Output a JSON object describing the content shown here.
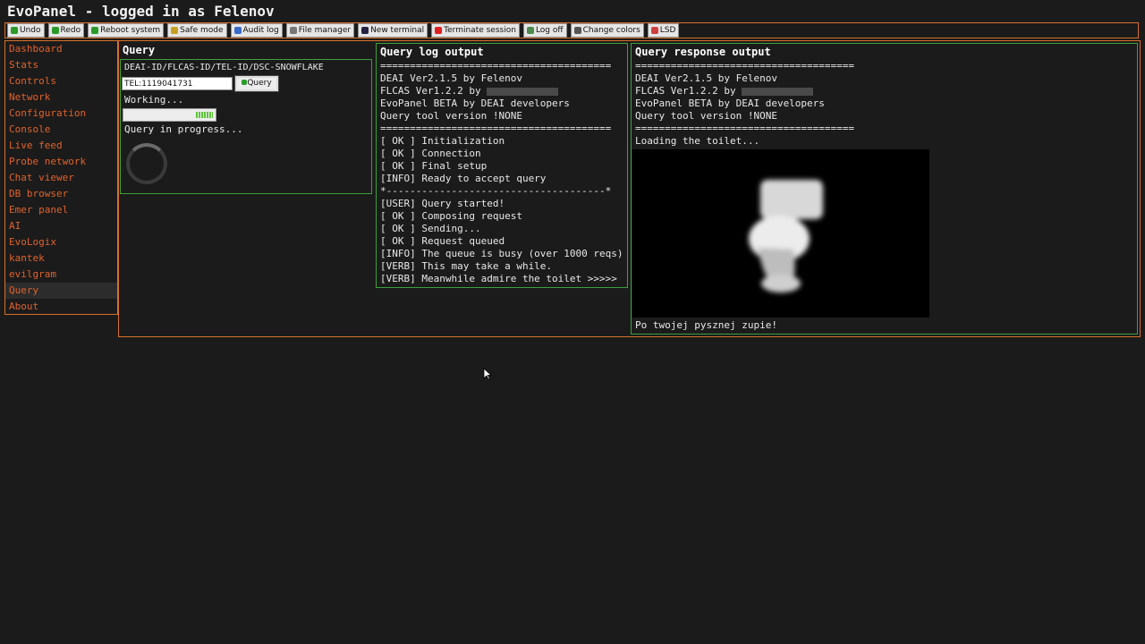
{
  "window": {
    "title": "EvoPanel - logged in as Felenov"
  },
  "toolbar": {
    "buttons": [
      {
        "label": "Undo",
        "icon": "undo-icon",
        "color": "#2a9a2a"
      },
      {
        "label": "Redo",
        "icon": "redo-icon",
        "color": "#2a9a2a"
      },
      {
        "label": "Reboot system",
        "icon": "reboot-icon",
        "color": "#2a9a2a"
      },
      {
        "label": "Safe mode",
        "icon": "safe-mode-icon",
        "color": "#c8a020"
      },
      {
        "label": "Audit log",
        "icon": "audit-log-icon",
        "color": "#3a6ac8"
      },
      {
        "label": "File manager",
        "icon": "file-manager-icon",
        "color": "#777777"
      },
      {
        "label": "New terminal",
        "icon": "terminal-icon",
        "color": "#222244"
      },
      {
        "label": "Terminate session",
        "icon": "terminate-icon",
        "color": "#e02020"
      },
      {
        "label": "Log off",
        "icon": "log-off-icon",
        "color": "#4a8a4a"
      },
      {
        "label": "Change colors",
        "icon": "palette-icon",
        "color": "#555555"
      },
      {
        "label": "LSD",
        "icon": "lsd-icon",
        "color": "#d04040"
      }
    ]
  },
  "sidebar": {
    "items": [
      "Dashboard",
      "Stats",
      "Controls",
      "Network",
      "Configuration",
      "Console",
      "Live feed",
      "Probe network",
      "Chat viewer",
      "DB browser",
      "Emer panel",
      "AI",
      "EvoLogix",
      "kantek",
      "evilgram",
      "Query",
      "About"
    ],
    "active": "Query"
  },
  "query": {
    "heading": "Query",
    "id_types": "DEAI-ID/FLCAS-ID/TEL-ID/DSC-SNOWFLAKE",
    "input_value": "TEL:1119041731",
    "button_label": "Query",
    "working": "Working...",
    "status": "Query in progress...",
    "progress_percent": 85
  },
  "log": {
    "heading": "Query log output",
    "lines": [
      "=======================================",
      "DEAI Ver2.1.5 by Felenov",
      "FLCAS Ver1.2.2 by ",
      "EvoPanel BETA by DEAI developers",
      "Query tool version !NONE",
      "=======================================",
      "[ OK ] Initialization",
      "[ OK ] Connection",
      "[ OK ] Final setup",
      "[INFO] Ready to accept query",
      "*-------------------------------------*",
      "[USER] Query started!",
      "[ OK ] Composing request",
      "[ OK ] Sending...",
      "[ OK ] Request queued",
      "[INFO] The queue is busy (over 1000 reqs)",
      "[VERB] This may take a while.",
      "[VERB] Meanwhile admire the toilet >>>>>"
    ]
  },
  "response": {
    "heading": "Query response output",
    "lines": [
      "=====================================",
      "DEAI Ver2.1.5 by Felenov",
      "FLCAS Ver1.2.2 by ",
      "EvoPanel BETA by DEAI developers",
      "Query tool version !NONE",
      "=====================================",
      "Loading the toilet..."
    ],
    "caption": "Po twojej pysznej zupie!"
  }
}
